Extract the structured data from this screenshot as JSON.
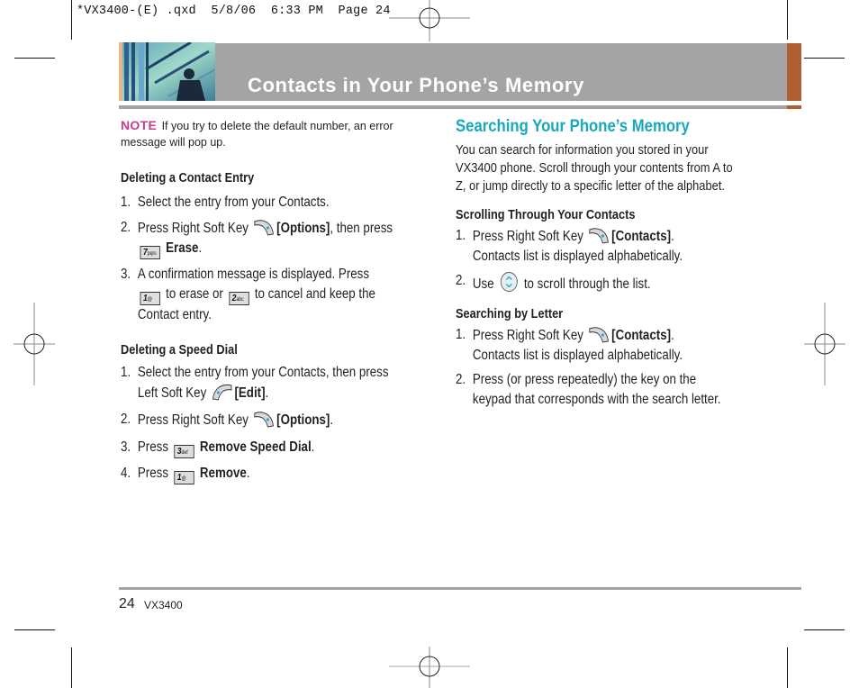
{
  "slug": {
    "text": "*VX3400-(E) .qxd  5/8/06  6:33 PM  Page 24"
  },
  "header": {
    "title": "Contacts in Your Phone’s Memory",
    "colors": {
      "bar": "#a5a3a4",
      "accent": "#ae5f33",
      "title": "#ffffff"
    }
  },
  "left": {
    "note": {
      "label": "NOTE",
      "line1": "If you try to delete the default number, an error",
      "line2": "message will pop up."
    },
    "deleting_contact": {
      "title": "Deleting a Contact Entry",
      "steps": [
        {
          "num": "1.",
          "text": "Select the entry from your Contacts."
        },
        {
          "num": "2.",
          "pre": "Press Right Soft Key",
          "bold": "[Options]",
          "post": ", then press",
          "key": "7",
          "key_sub": "pqrs",
          "bold2": "Erase",
          "post2": "."
        },
        {
          "num": "3.",
          "line1": "A confirmation message is displayed. Press",
          "key1": "1",
          "key1_sub": "@",
          "mid": "to erase or",
          "key2": "2",
          "key2_sub": "abc",
          "end": "to cancel and keep the",
          "line3": "Contact entry."
        }
      ]
    },
    "deleting_speed": {
      "title": "Deleting a Speed Dial",
      "steps": [
        {
          "num": "1.",
          "line1": "Select the entry from your Contacts, then press",
          "pre": "Left Soft Key",
          "bold": "[Edit]",
          "post": "."
        },
        {
          "num": "2.",
          "pre": "Press Right Soft Key",
          "bold": "[Options]",
          "post": "."
        },
        {
          "num": "3.",
          "pre": "Press",
          "key": "3",
          "key_sub": "def",
          "bold": "Remove Speed Dial",
          "post": "."
        },
        {
          "num": "4.",
          "pre": "Press",
          "key": "1",
          "key_sub": "@",
          "bold": "Remove",
          "post": "."
        }
      ]
    }
  },
  "right": {
    "title": "Searching Your Phone’s Memory",
    "intro": [
      "You can search for information you stored in your",
      "VX3400 phone. Scroll through your contents from A to",
      "Z, or jump directly to a specific letter of the alphabet."
    ],
    "scrolling": {
      "title": "Scrolling Through Your Contacts",
      "steps": [
        {
          "num": "1.",
          "pre": "Press Right Soft Key",
          "bold": "[Contacts]",
          "post": ".",
          "line2": "Contacts list is displayed alphabetically."
        },
        {
          "num": "2.",
          "pre": "Use",
          "post": "to scroll through the list."
        }
      ]
    },
    "by_letter": {
      "title": "Searching by Letter",
      "steps": [
        {
          "num": "1.",
          "pre": "Press Right Soft Key",
          "bold": "[Contacts]",
          "post": ".",
          "line2": "Contacts list is displayed alphabetically."
        },
        {
          "num": "2.",
          "line1": "Press (or press repeatedly) the key on the",
          "line2": "keypad that corresponds with the search letter."
        }
      ]
    },
    "colors": {
      "title": "#18a8bd"
    }
  },
  "footer": {
    "page_number": "24",
    "model": "VX3400"
  }
}
